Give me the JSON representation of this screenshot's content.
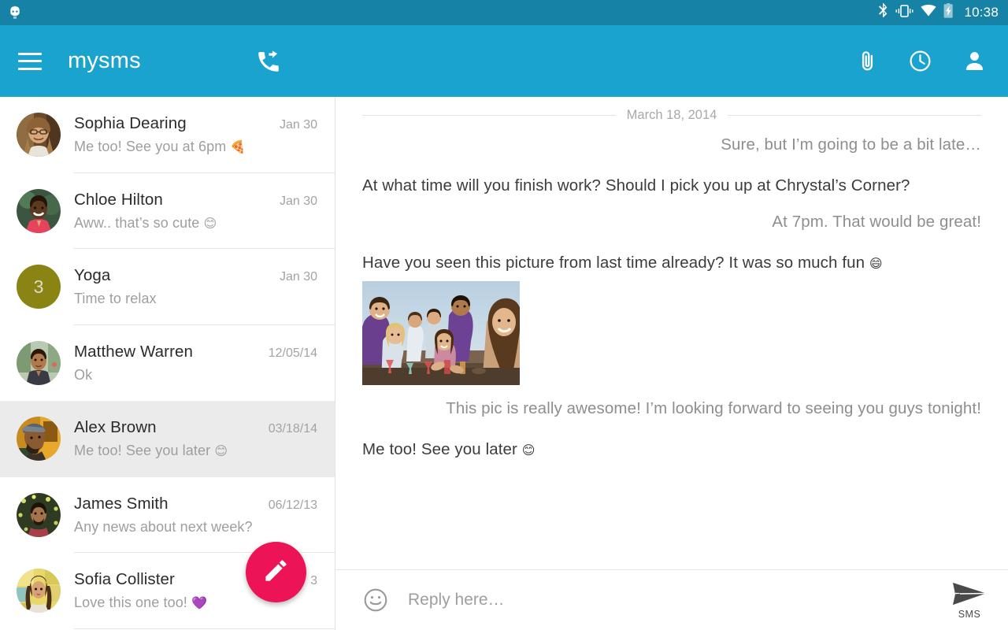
{
  "status_bar": {
    "left_icon": "cyanogenmod-logo",
    "icons": [
      "bluetooth-icon",
      "vibrate-icon",
      "wifi-icon",
      "battery-charging-icon"
    ],
    "time": "10:38",
    "background": "#1682A5"
  },
  "app_bar": {
    "menu_icon": "hamburger-menu-icon",
    "title": "mysms",
    "callback_icon": "call-forward-icon",
    "actions": [
      {
        "icon": "attachment-icon"
      },
      {
        "icon": "clock-icon"
      },
      {
        "icon": "person-icon"
      }
    ],
    "background": "#1BA3D0"
  },
  "conversation_list": {
    "fab": {
      "icon": "compose-pencil-icon",
      "color": "#EC1457"
    },
    "selected_index": 4,
    "items": [
      {
        "name": "Sophia Dearing",
        "date": "Jan 30",
        "snippet": "Me too! See you at 6pm ",
        "emoji": "🍕",
        "avatar": "photo-sophia"
      },
      {
        "name": "Chloe Hilton",
        "date": "Jan 30",
        "snippet": "Aww.. that’s so cute ",
        "emoji": "😊",
        "avatar": "photo-chloe"
      },
      {
        "name": "Yoga",
        "date": "Jan 30",
        "snippet": "Time to relax",
        "emoji": "",
        "avatar": "initial-3",
        "initial": "3",
        "avatar_color": "#8a8415"
      },
      {
        "name": "Matthew Warren",
        "date": "12/05/14",
        "snippet": "Ok",
        "emoji": "",
        "avatar": "photo-matthew"
      },
      {
        "name": "Alex Brown",
        "date": "03/18/14",
        "snippet": "Me too! See you later ",
        "emoji": "😊",
        "avatar": "photo-alex"
      },
      {
        "name": "James Smith",
        "date": "06/12/13",
        "snippet": "Any news about next week?",
        "emoji": "",
        "avatar": "photo-james"
      },
      {
        "name": "Sofia Collister",
        "date": "3",
        "snippet": "Love this one too! ",
        "emoji": "💜",
        "avatar": "photo-sofia"
      }
    ]
  },
  "thread": {
    "date_separator": "March 18, 2014",
    "messages": [
      {
        "direction": "outgoing",
        "text": "Sure, but I’m going to be a bit late…",
        "emoji": ""
      },
      {
        "direction": "incoming",
        "text": "At what time will you finish work? Should I pick you up at Chrystal’s Corner?",
        "emoji": ""
      },
      {
        "direction": "outgoing",
        "text": "At 7pm. That would be great!",
        "emoji": ""
      },
      {
        "direction": "incoming",
        "text": "Have you seen this picture from last time already? It was so much fun ",
        "emoji": "😄",
        "attachment": "photo-friends-celebrating"
      },
      {
        "direction": "outgoing",
        "text": "This pic is really awesome! I’m looking forward to seeing you guys tonight!",
        "emoji": ""
      },
      {
        "direction": "incoming",
        "text": "Me too! See you later ",
        "emoji": "😊"
      }
    ]
  },
  "reply_bar": {
    "emoji_icon": "emoji-smiley-icon",
    "placeholder": "Reply here…",
    "value": "",
    "send_icon": "send-arrow-icon",
    "send_label": "SMS"
  }
}
